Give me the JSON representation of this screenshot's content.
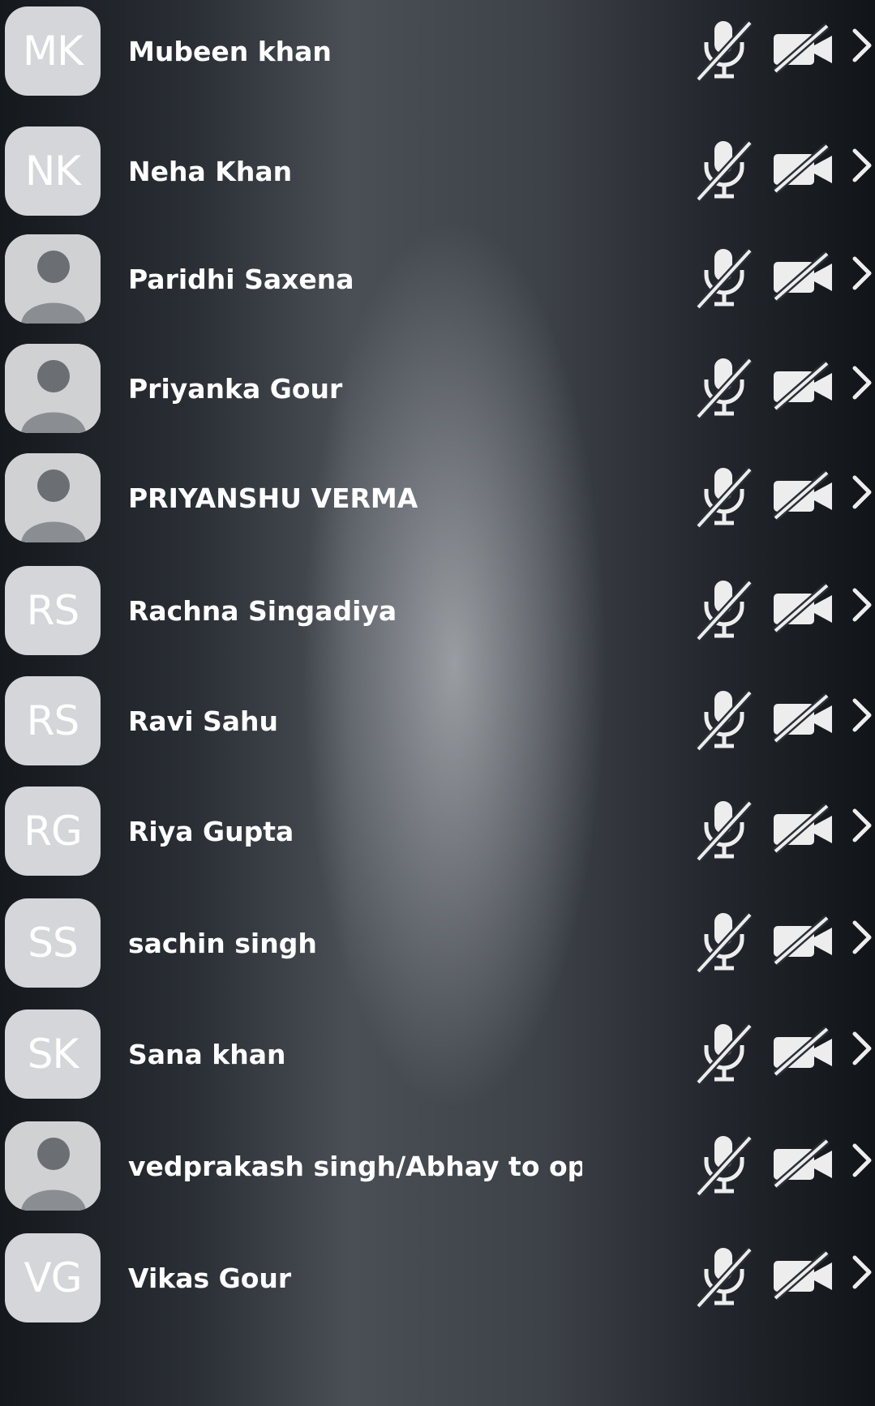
{
  "participants": [
    {
      "initials": "MK",
      "name": "Mubeen khan",
      "avatar_type": "initials",
      "mic_muted": true,
      "video_off": true
    },
    {
      "initials": "NK",
      "name": "Neha Khan",
      "avatar_type": "initials",
      "mic_muted": true,
      "video_off": true
    },
    {
      "initials": "",
      "name": "Paridhi Saxena",
      "avatar_type": "photo",
      "mic_muted": true,
      "video_off": true
    },
    {
      "initials": "",
      "name": "Priyanka Gour",
      "avatar_type": "photo",
      "mic_muted": true,
      "video_off": true
    },
    {
      "initials": "",
      "name": "PRIYANSHU VERMA",
      "avatar_type": "photo",
      "mic_muted": true,
      "video_off": true
    },
    {
      "initials": "RS",
      "name": "Rachna Singadiya",
      "avatar_type": "initials",
      "mic_muted": true,
      "video_off": true
    },
    {
      "initials": "RS",
      "name": "Ravi Sahu",
      "avatar_type": "initials",
      "mic_muted": true,
      "video_off": true
    },
    {
      "initials": "RG",
      "name": "Riya Gupta",
      "avatar_type": "initials",
      "mic_muted": true,
      "video_off": true
    },
    {
      "initials": "SS",
      "name": "sachin singh",
      "avatar_type": "initials",
      "mic_muted": true,
      "video_off": true
    },
    {
      "initials": "SK",
      "name": "Sana khan",
      "avatar_type": "initials",
      "mic_muted": true,
      "video_off": true
    },
    {
      "initials": "",
      "name": "vedprakash singh/Abhay to open",
      "avatar_type": "photo",
      "mic_muted": true,
      "video_off": true
    },
    {
      "initials": "VG",
      "name": "Vikas Gour",
      "avatar_type": "initials",
      "mic_muted": true,
      "video_off": true
    }
  ],
  "icons": {
    "mic": "mic-muted-icon",
    "video": "video-off-icon",
    "chevron": "chevron-right-icon"
  },
  "colors": {
    "text": "#ffffff",
    "avatar_bg": "#d4d6d9",
    "icon": "#ededed",
    "background": "#2b3036"
  }
}
